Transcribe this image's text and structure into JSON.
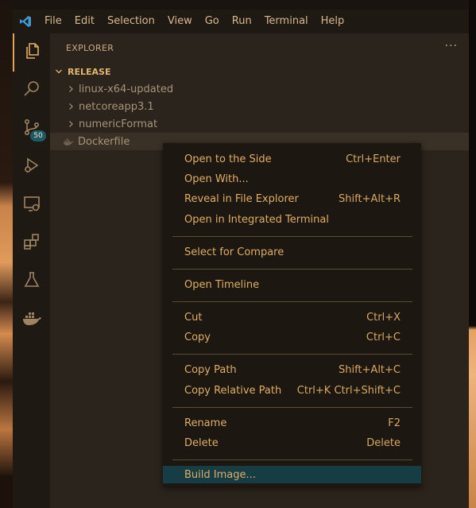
{
  "menu": [
    "File",
    "Edit",
    "Selection",
    "View",
    "Go",
    "Run",
    "Terminal",
    "Help"
  ],
  "activity": {
    "scm_badge": "50"
  },
  "explorer": {
    "title": "EXPLORER",
    "more": "···",
    "section": "RELEASE",
    "items": [
      {
        "label": "linux-x64-updated",
        "type": "folder"
      },
      {
        "label": "netcoreapp3.1",
        "type": "folder"
      },
      {
        "label": "numericFormat",
        "type": "folder"
      },
      {
        "label": "Dockerfile",
        "type": "file"
      }
    ]
  },
  "context_menu": {
    "items": [
      {
        "label": "Open to the Side",
        "shortcut": "Ctrl+Enter"
      },
      {
        "label": "Open With...",
        "shortcut": ""
      },
      {
        "label": "Reveal in File Explorer",
        "shortcut": "Shift+Alt+R"
      },
      {
        "label": "Open in Integrated Terminal",
        "shortcut": ""
      },
      {
        "label": "Select for Compare",
        "shortcut": ""
      },
      {
        "label": "Open Timeline",
        "shortcut": ""
      },
      {
        "label": "Cut",
        "shortcut": "Ctrl+X"
      },
      {
        "label": "Copy",
        "shortcut": "Ctrl+C"
      },
      {
        "label": "Copy Path",
        "shortcut": "Shift+Alt+C"
      },
      {
        "label": "Copy Relative Path",
        "shortcut": "Ctrl+K Ctrl+Shift+C"
      },
      {
        "label": "Rename",
        "shortcut": "F2"
      },
      {
        "label": "Delete",
        "shortcut": "Delete"
      },
      {
        "label": "Build Image...",
        "shortcut": ""
      }
    ]
  },
  "colors": {
    "accent": "#e0ad66",
    "highlight": "#163c44",
    "badge": "#1e5a61"
  }
}
